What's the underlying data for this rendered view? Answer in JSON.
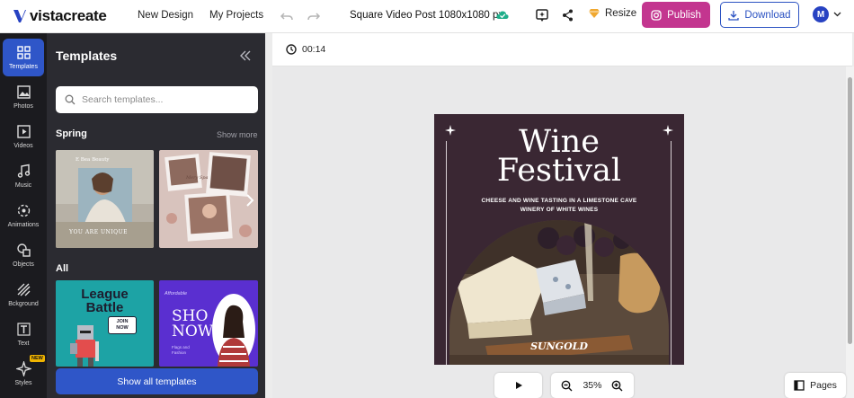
{
  "topbar": {
    "logo_text": "vistacreate",
    "nav": {
      "new_design": "New Design",
      "my_projects": "My Projects"
    },
    "doc_title": "Square Video Post 1080x1080 px",
    "resize_label": "Resize",
    "publish_label": "Publish",
    "download_label": "Download",
    "avatar_initial": "M"
  },
  "rail": {
    "items": [
      {
        "label": "Templates",
        "icon": "templates-icon",
        "active": true
      },
      {
        "label": "Photos",
        "icon": "photo-icon"
      },
      {
        "label": "Videos",
        "icon": "video-icon"
      },
      {
        "label": "Music",
        "icon": "music-icon"
      },
      {
        "label": "Animations",
        "icon": "animation-icon"
      },
      {
        "label": "Objects",
        "icon": "objects-icon"
      },
      {
        "label": "Bckground",
        "icon": "background-icon"
      },
      {
        "label": "Text",
        "icon": "text-icon"
      },
      {
        "label": "Styles",
        "icon": "styles-icon"
      }
    ],
    "new_badge": "NEW"
  },
  "panel": {
    "title": "Templates",
    "search_placeholder": "Search templates...",
    "spring_title": "Spring",
    "show_more": "Show more",
    "all_title": "All",
    "show_all": "Show all templates",
    "thumb_texts": {
      "spring1_top": "E Bea Beauty",
      "spring1_bottom": "YOU ARE UNIQUE",
      "spring2_caption": "Mery Spa",
      "all1_line1": "League",
      "all1_line2": "Battle",
      "all1_badge1": "JOIN",
      "all1_badge2": "NOW",
      "all2_small": "Affordable",
      "all2_big1": "SHO",
      "all2_big2": "NOW",
      "all2_tiny": "Flags and Fashion"
    }
  },
  "canvas": {
    "timer": "00:14",
    "poster": {
      "title_line1": "Wine",
      "title_line2": "Festival",
      "subtitle": "CHEESE AND WINE TASTING IN A LIMESTONE CAVE WINERY OF WHITE WINES",
      "brand": "SUNGOLD"
    },
    "zoom": "35%",
    "pages_label": "Pages"
  },
  "colors": {
    "brand_blue": "#2f56c8",
    "publish_magenta": "#c3358f",
    "poster_bg": "#3a2733"
  }
}
